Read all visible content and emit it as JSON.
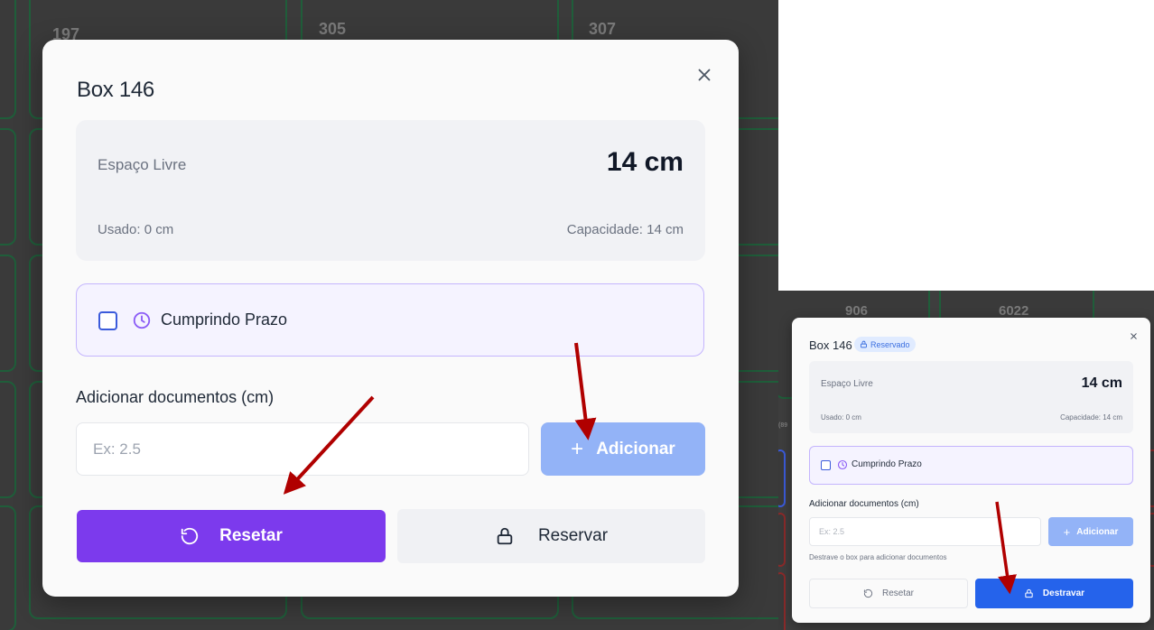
{
  "background_tiles_left": [
    "197",
    "305",
    "307"
  ],
  "background_tiles_right": [
    "906",
    "6022",
    "(89"
  ],
  "large_modal": {
    "title": "Box 146",
    "free_space_label": "Espaço Livre",
    "free_space_value": "14 cm",
    "used_label": "Usado: 0 cm",
    "capacity_label": "Capacidade: 14 cm",
    "deadline_label": "Cumprindo Prazo",
    "add_docs_label": "Adicionar documentos (cm)",
    "input_placeholder": "Ex: 2.5",
    "add_button_label": "Adicionar",
    "reset_button_label": "Resetar",
    "reserve_button_label": "Reservar"
  },
  "small_modal": {
    "title": "Box 146",
    "badge": "Reservado",
    "free_space_label": "Espaço Livre",
    "free_space_value": "14 cm",
    "used_label": "Usado: 0 cm",
    "capacity_label": "Capacidade: 14 cm",
    "deadline_label": "Cumprindo Prazo",
    "add_docs_label": "Adicionar documentos (cm)",
    "input_placeholder": "Ex: 2.5",
    "add_button_label": "Adicionar",
    "hint": "Destrave o box para adicionar documentos",
    "reset_button_label": "Resetar",
    "unlock_button_label": "Destravar"
  },
  "colors": {
    "primary_purple": "#7c3aed",
    "primary_blue": "#2563eb",
    "disabled_blue": "#93b3f7",
    "arrow_red": "#b00000",
    "clock_purple": "#8b5cf6"
  }
}
